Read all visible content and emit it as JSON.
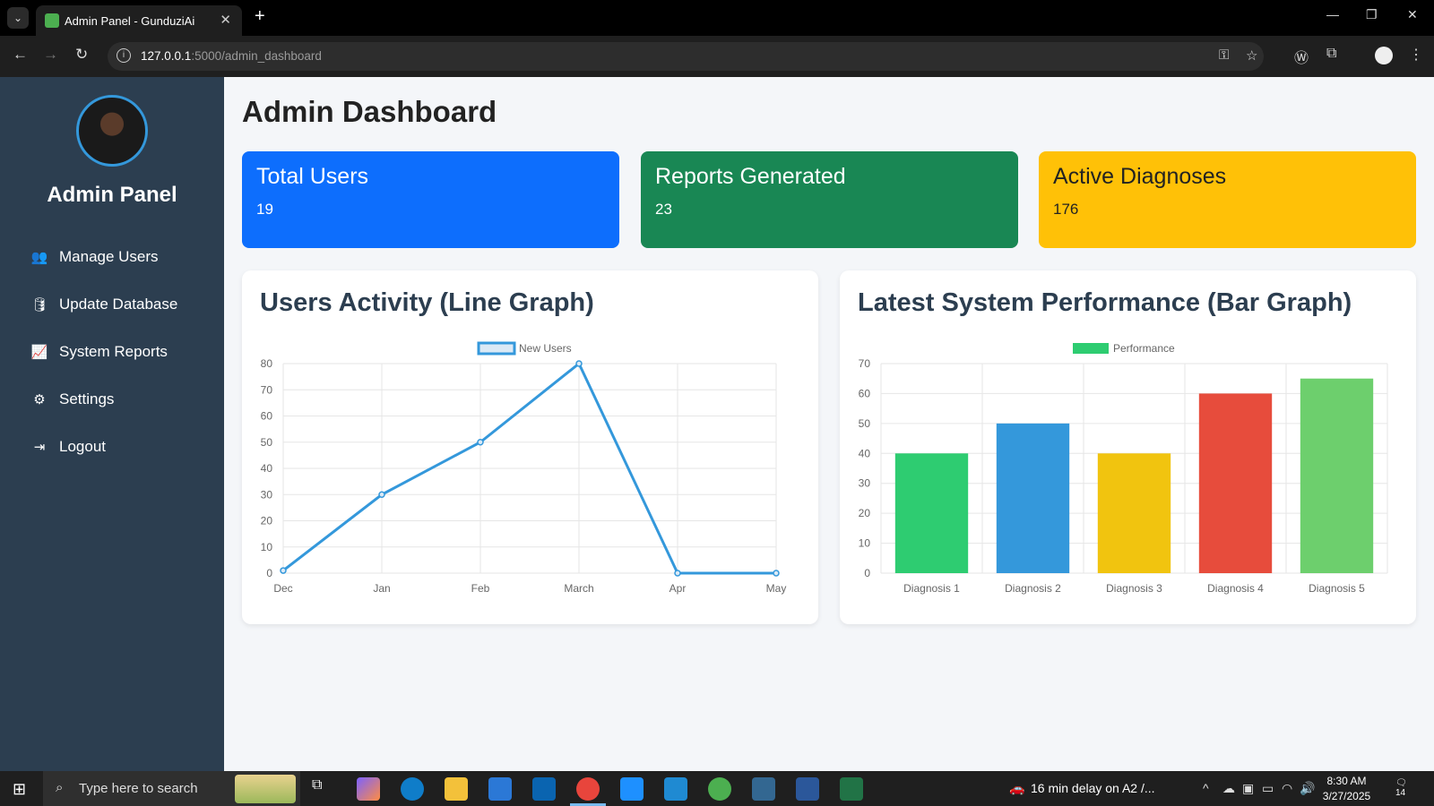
{
  "browser": {
    "tab_title": "Admin Panel - GunduziAi",
    "url_host": "127.0.0.1",
    "url_path": ":5000/admin_dashboard"
  },
  "sidebar": {
    "title": "Admin Panel",
    "items": [
      {
        "label": "Manage Users",
        "icon": "users-icon"
      },
      {
        "label": "Update Database",
        "icon": "database-icon"
      },
      {
        "label": "System Reports",
        "icon": "chart-line-icon"
      },
      {
        "label": "Settings",
        "icon": "gears-icon"
      },
      {
        "label": "Logout",
        "icon": "sign-out-icon"
      }
    ]
  },
  "main": {
    "title": "Admin Dashboard",
    "stats": [
      {
        "label": "Total Users",
        "value": "19",
        "color": "#0d6efd"
      },
      {
        "label": "Reports Generated",
        "value": "23",
        "color": "#198754"
      },
      {
        "label": "Active Diagnoses",
        "value": "176",
        "color": "#ffc107"
      }
    ],
    "line_card_title": "Users Activity (Line Graph)",
    "bar_card_title": "Latest System Performance (Bar Graph)"
  },
  "chart_data": [
    {
      "type": "line",
      "legend": "New Users",
      "categories": [
        "Dec",
        "Jan",
        "Feb",
        "March",
        "Apr",
        "May"
      ],
      "series": [
        {
          "name": "New Users",
          "values": [
            1,
            30,
            50,
            80,
            0,
            0
          ]
        }
      ],
      "ylim": [
        0,
        80
      ],
      "yticks": [
        0,
        10,
        20,
        30,
        40,
        50,
        60,
        70,
        80
      ],
      "color": "#3498db",
      "grid": true,
      "legend_position": "top"
    },
    {
      "type": "bar",
      "legend": "Performance",
      "categories": [
        "Diagnosis 1",
        "Diagnosis 2",
        "Diagnosis 3",
        "Diagnosis 4",
        "Diagnosis 5"
      ],
      "series": [
        {
          "name": "Performance",
          "values": [
            40,
            50,
            40,
            60,
            65
          ]
        }
      ],
      "bar_colors": [
        "#2ecc71",
        "#3498db",
        "#f1c40f",
        "#e74c3c",
        "#6dcf6d"
      ],
      "ylim": [
        0,
        70
      ],
      "yticks": [
        0,
        10,
        20,
        30,
        40,
        50,
        60,
        70
      ],
      "grid": true,
      "legend_position": "top"
    }
  ],
  "taskbar": {
    "search_placeholder": "Type here to search",
    "notice": "16 min delay on A2 /...",
    "time": "8:30 AM",
    "date": "3/27/2025",
    "notifications": "14"
  }
}
